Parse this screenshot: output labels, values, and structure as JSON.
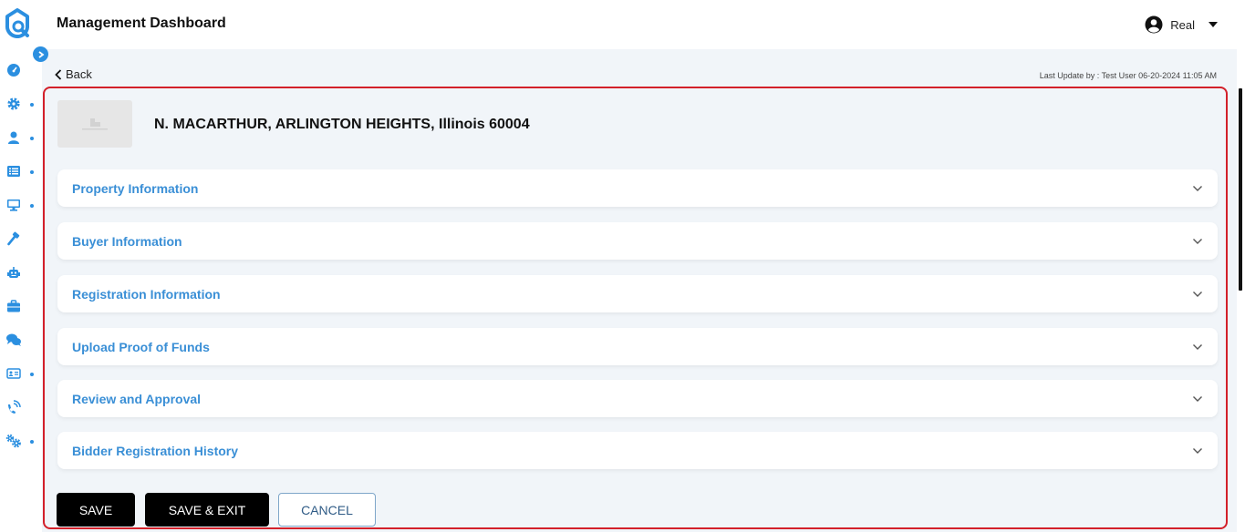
{
  "app": {
    "title": "Management Dashboard",
    "brand_color": "#2b8fe0",
    "accent_label_color": "#3a8fd6",
    "highlight_border_color": "#d3202a"
  },
  "user_menu": {
    "icon": "user-circle-icon",
    "name": "Real",
    "caret": "caret-down-icon"
  },
  "sidebar": {
    "logo": "q-search-logo",
    "expand_icon": "chevron-right-icon",
    "items": [
      {
        "icon": "dashboard-gauge-icon",
        "has_submenu": false
      },
      {
        "icon": "gear-icon",
        "has_submenu": true
      },
      {
        "icon": "user-icon",
        "has_submenu": true
      },
      {
        "icon": "list-icon",
        "has_submenu": true
      },
      {
        "icon": "monitor-icon",
        "has_submenu": true
      },
      {
        "icon": "hammer-icon",
        "has_submenu": false
      },
      {
        "icon": "robot-icon",
        "has_submenu": false
      },
      {
        "icon": "briefcase-icon",
        "has_submenu": false
      },
      {
        "icon": "chat-bubbles-icon",
        "has_submenu": false
      },
      {
        "icon": "id-card-icon",
        "has_submenu": true
      },
      {
        "icon": "phone-signal-icon",
        "has_submenu": false
      },
      {
        "icon": "gears-icon",
        "has_submenu": true
      }
    ]
  },
  "nav": {
    "back_label": "Back",
    "last_update": "Last Update by : Test User 06-20-2024 11:05 AM"
  },
  "property": {
    "address": "N. MACARTHUR, ARLINGTON HEIGHTS, Illinois 60004",
    "thumbnail_icon": "image-placeholder-icon"
  },
  "sections": [
    {
      "label": "Property Information"
    },
    {
      "label": "Buyer Information"
    },
    {
      "label": "Registration Information"
    },
    {
      "label": "Upload Proof of Funds"
    },
    {
      "label": "Review and Approval"
    },
    {
      "label": "Bidder Registration History"
    }
  ],
  "actions": {
    "save": "SAVE",
    "save_exit": "SAVE & EXIT",
    "cancel": "CANCEL"
  }
}
